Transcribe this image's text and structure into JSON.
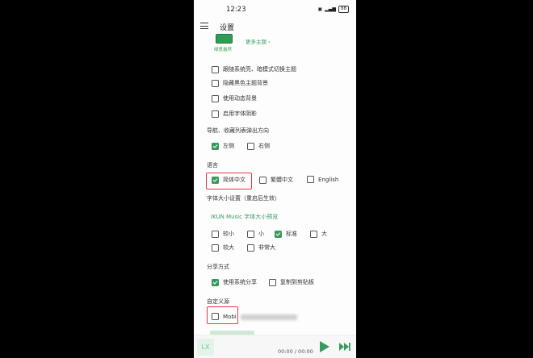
{
  "status": {
    "time": "12:23",
    "battery": "88"
  },
  "app": {
    "title": "设置"
  },
  "theme": {
    "current_name": "绿意盎然",
    "more_link": "更多主题"
  },
  "theme_options": [
    {
      "label": "跟随系统亮、暗模式切换主题",
      "checked": false
    },
    {
      "label": "隐藏黑色主题背景",
      "checked": false
    },
    {
      "label": "使用动态背景",
      "checked": false
    },
    {
      "label": "启用字体阴影",
      "checked": false
    }
  ],
  "nav_direction": {
    "title": "导航、收藏列表弹出方向",
    "options": [
      {
        "label": "左侧",
        "checked": true
      },
      {
        "label": "右侧",
        "checked": false
      }
    ]
  },
  "language": {
    "title": "语言",
    "options": [
      {
        "label": "简体中文",
        "checked": true
      },
      {
        "label": "繁體中文",
        "checked": false
      },
      {
        "label": "English",
        "checked": false
      }
    ]
  },
  "font_size": {
    "title": "字体大小设置（重启后生效）",
    "preview": "IKUN Music 字体大小预览",
    "options": [
      {
        "label": "较小",
        "checked": false
      },
      {
        "label": "小",
        "checked": false
      },
      {
        "label": "标准",
        "checked": true
      },
      {
        "label": "大",
        "checked": false
      },
      {
        "label": "较大",
        "checked": false
      },
      {
        "label": "非常大",
        "checked": false
      }
    ]
  },
  "share": {
    "title": "分享方式",
    "options": [
      {
        "label": "使用系统分享",
        "checked": true
      },
      {
        "label": "复制到剪贴板",
        "checked": false
      }
    ]
  },
  "custom_source": {
    "title": "自定义源",
    "option_label": "Mobi",
    "checked": false
  },
  "player": {
    "logo": "LX",
    "time": "00:00 / 00:00"
  },
  "colors": {
    "accent": "#3a9a5e",
    "highlight": "#e8374a"
  }
}
